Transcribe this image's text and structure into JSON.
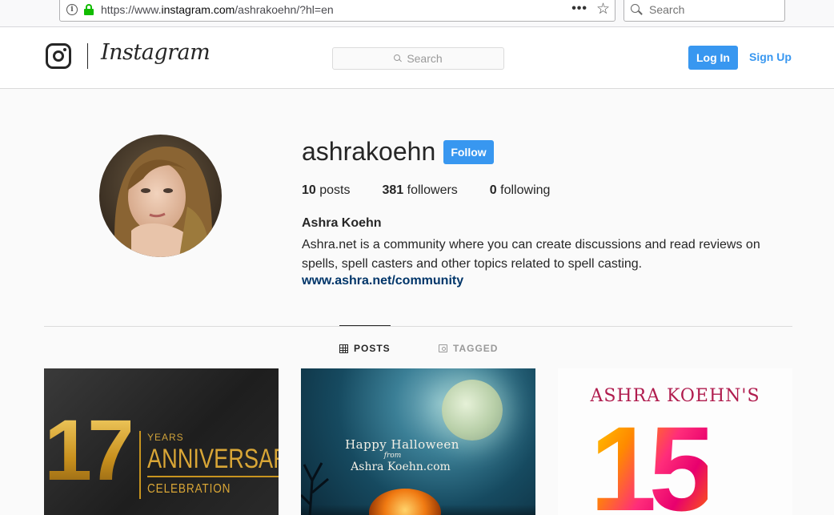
{
  "browser": {
    "url_prefix": "https://www.",
    "url_host": "instagram.com",
    "url_path": "/ashrakoehn/?hl=en",
    "menu_dots": "•••",
    "search_placeholder": "Search"
  },
  "header": {
    "wordmark": "Instagram",
    "search_placeholder": "Search",
    "login_label": "Log In",
    "signup_label": "Sign Up"
  },
  "profile": {
    "username": "ashrakoehn",
    "follow_label": "Follow",
    "posts_count": "10",
    "posts_label": "posts",
    "followers_count": "381",
    "followers_label": "followers",
    "following_count": "0",
    "following_label": "following",
    "full_name": "Ashra Koehn",
    "bio_line1": "Ashra.net is a community where you can create discussions and read reviews on",
    "bio_line2": "spells, spell casters and other topics related to spell casting.",
    "website": "www.ashra.net/community"
  },
  "tabs": {
    "posts": "POSTS",
    "tagged": "TAGGED"
  },
  "posts": [
    {
      "number": "17",
      "line1": "YEARS",
      "line2": "ANNIVERSARY",
      "line3": "CELEBRATION"
    },
    {
      "line1": "Happy Halloween",
      "line2": "from",
      "line3": "Ashra Koehn.com"
    },
    {
      "title": "ASHRA KOEHN'S",
      "number": "15"
    }
  ],
  "colors": {
    "accent": "#3897f0",
    "link": "#003569",
    "text": "#262626",
    "muted": "#999999"
  }
}
